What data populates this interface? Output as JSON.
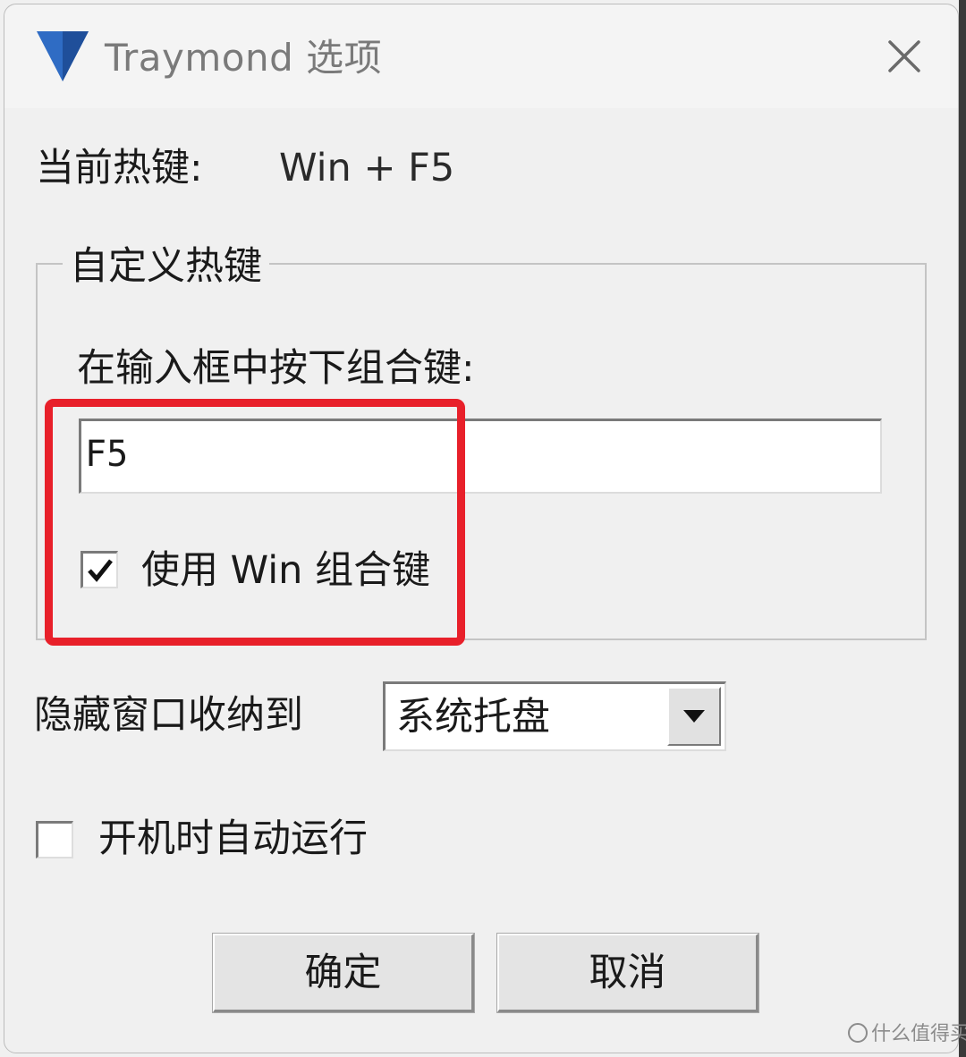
{
  "window": {
    "title": "Traymond 选项",
    "close_glyph": "✕"
  },
  "current_hotkey": {
    "label": "当前热键:",
    "value": "Win + F5"
  },
  "custom_hotkey": {
    "group_title": "自定义热键",
    "instruction": "在输入框中按下组合键:",
    "input_value": "F5",
    "use_win_checkbox": {
      "label": "使用 Win 组合键",
      "checked": true
    }
  },
  "minimize_to": {
    "label": "隐藏窗口收纳到",
    "selected": "系统托盘"
  },
  "autostart": {
    "label": "开机时自动运行",
    "checked": false
  },
  "buttons": {
    "ok_label": "确定",
    "cancel_label": "取消"
  },
  "watermark": {
    "text": "什么值得买"
  },
  "colors": {
    "highlight": "#e8202a",
    "icon_blue": "#2f6cc4"
  }
}
